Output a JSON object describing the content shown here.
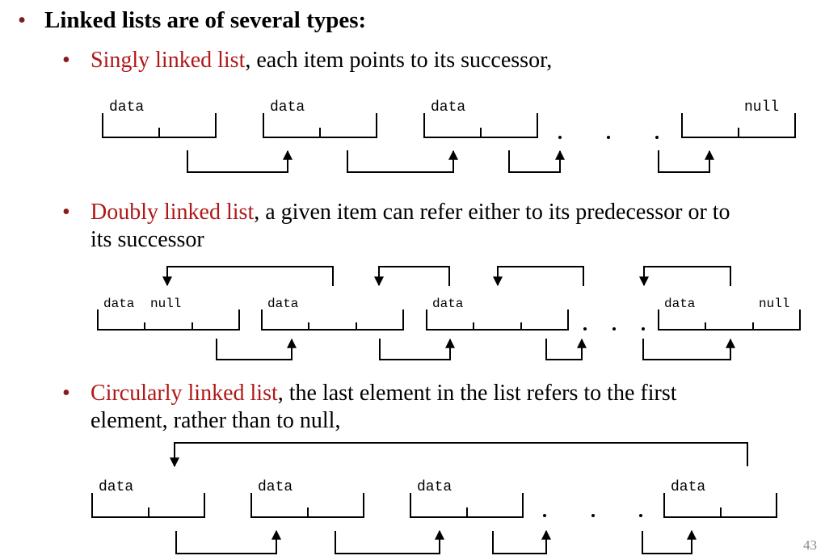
{
  "heading": "Linked lists are of several types:",
  "items": [
    {
      "term": "Singly linked list",
      "rest": ", each item points to its successor,"
    },
    {
      "term": "Doubly linked list",
      "rest": ", a given item can refer either to its predecessor or to",
      "rest2": "its successor"
    },
    {
      "term": "Circularly linked list",
      "rest": ", the last element in the list refers to the first",
      "rest2": "element, rather than to null,"
    }
  ],
  "labels": {
    "data": "data",
    "null": "null"
  },
  "page_number": "43",
  "colors": {
    "term": "#b01818",
    "bullet": "#8b1a1a",
    "line": "#000000",
    "page_number": "#888888"
  }
}
